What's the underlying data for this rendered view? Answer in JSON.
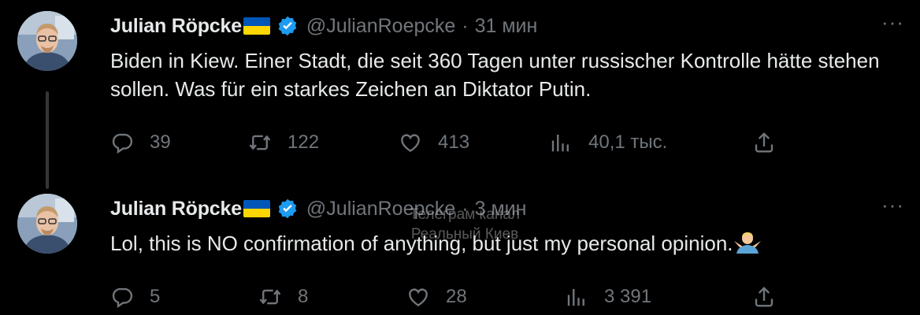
{
  "tweets": [
    {
      "author": "Julian Röpcke",
      "handle": "@JulianRoepcke",
      "separator": "·",
      "time": "31 мин",
      "text": "Biden in Kiew. Einer Stadt, die seit 360 Tagen unter russischer Kontrolle hätte stehen sollen. Was für ein starkes Zeichen an Diktator Putin.",
      "replies": "39",
      "retweets": "122",
      "likes": "413",
      "views": "40,1 тыс."
    },
    {
      "author": "Julian Röpcke",
      "handle": "@JulianRoepcke",
      "separator": "·",
      "time": "3 мин",
      "text": "Lol, this is NO confirmation of anything, but just my personal opinion.",
      "emoji": "man-shrugging",
      "replies": "5",
      "retweets": "8",
      "likes": "28",
      "views": "3 391"
    }
  ],
  "watermark": {
    "line1": "Телеграм канал",
    "line2": "Реальный Киев"
  },
  "more_label": "···",
  "colors": {
    "background": "#000000",
    "text": "#e7e9ea",
    "muted": "#71767b",
    "verified": "#1d9bf0",
    "flag_blue": "#0057b7",
    "flag_yellow": "#ffd700"
  }
}
